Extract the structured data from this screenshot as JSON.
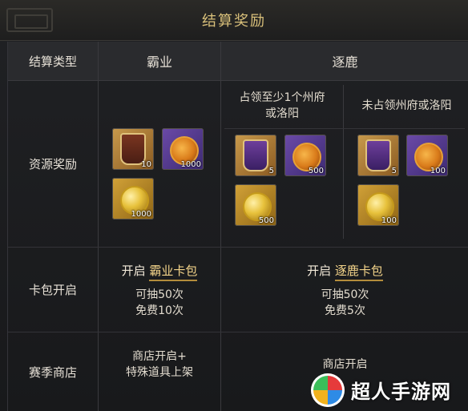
{
  "title": "结算奖励",
  "header": {
    "settlement_type": "结算类型",
    "bayie": "霸业",
    "zhulu": "逐鹿"
  },
  "zhulu_subcols": {
    "occupy": "占领至少1个州府或洛阳",
    "not_occupy": "未占领州府或洛阳"
  },
  "rows": {
    "resource_reward": "资源奖励",
    "card_pack": "卡包开启",
    "season_shop": "赛季商店"
  },
  "resources": {
    "bayie": [
      {
        "icon": "badge-icon",
        "count": "10"
      },
      {
        "icon": "swirl-coin-icon",
        "count": "1000"
      },
      {
        "icon": "gold-coin-icon",
        "count": "1000"
      }
    ],
    "zhulu_occupy": [
      {
        "icon": "badge-icon",
        "count": "5"
      },
      {
        "icon": "swirl-coin-icon",
        "count": "500"
      },
      {
        "icon": "gold-coin-icon",
        "count": "500"
      }
    ],
    "zhulu_not_occupy": [
      {
        "icon": "badge-icon",
        "count": "5"
      },
      {
        "icon": "swirl-coin-icon",
        "count": "100"
      },
      {
        "icon": "gold-coin-icon",
        "count": "100"
      }
    ]
  },
  "card_pack": {
    "bayie_prefix": "开启",
    "bayie_name": "霸业卡包",
    "bayie_draw": "可抽50次",
    "bayie_free": "免费10次",
    "zhulu_prefix": "开启",
    "zhulu_name": "逐鹿卡包",
    "zhulu_draw": "可抽50次",
    "zhulu_free": "免费5次"
  },
  "shop": {
    "bayie_line1": "商店开启+",
    "bayie_line2": "特殊道具上架",
    "zhulu": "商店开启"
  },
  "watermark": "超人手游网",
  "colors": {
    "title": "#d9c07a",
    "highlight": "#f4d48a"
  }
}
